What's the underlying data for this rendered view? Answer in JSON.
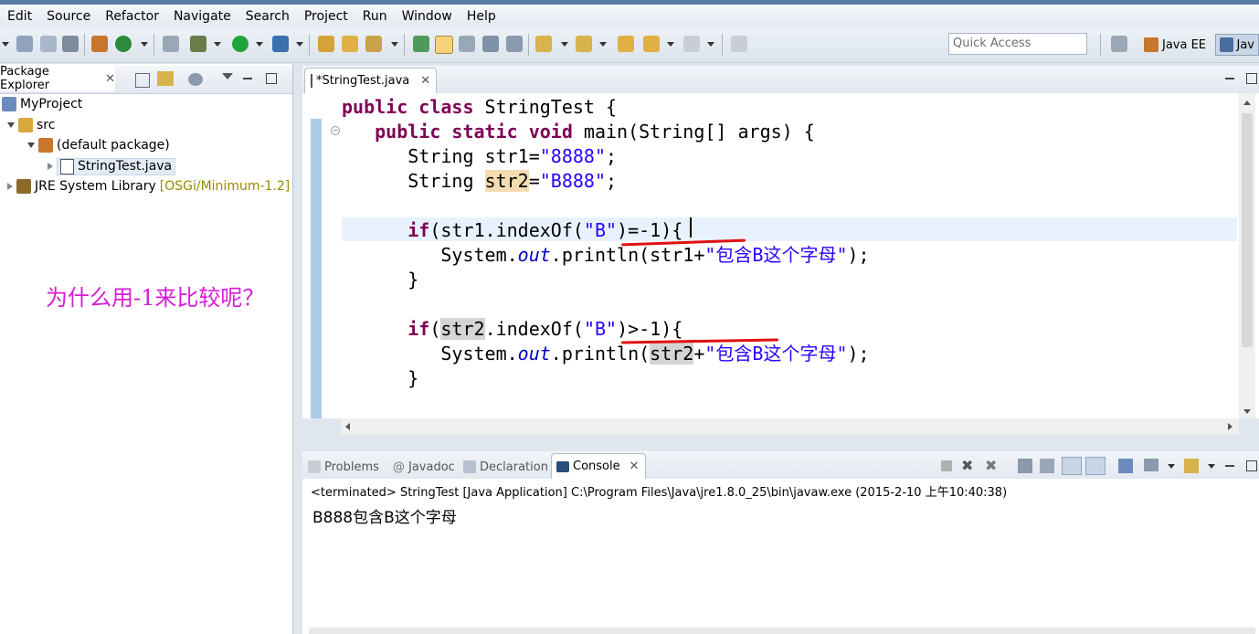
{
  "menu": [
    "Edit",
    "Source",
    "Refactor",
    "Navigate",
    "Search",
    "Project",
    "Run",
    "Window",
    "Help"
  ],
  "toolbar": {
    "quick_access_placeholder": "Quick Access",
    "perspective_java_ee": "Java EE",
    "perspective_java": "Jav"
  },
  "package_explorer": {
    "tab_label": "Package Explorer",
    "project": "MyProject",
    "src": "src",
    "package": "(default package)",
    "file": "StringTest.java",
    "jre_label": "JRE System Library",
    "jre_version": "[OSGi/Minimum-1.2]"
  },
  "annotation": {
    "question": "为什么用-1来比较呢？"
  },
  "editor": {
    "tab_label": "*StringTest.java",
    "line1": {
      "kw1": "public",
      "kw2": "class",
      "rest": " StringTest {"
    },
    "line2": {
      "kw1": "public",
      "kw2": "static",
      "kw3": "void",
      "rest": " main(String[] args) {"
    },
    "line3": {
      "a": "String str1=",
      "s": "\"8888\"",
      "b": ";"
    },
    "line4": {
      "a": "String ",
      "var": "str2",
      "b": "=",
      "s": "\"B888\"",
      "c": ";"
    },
    "line5": {
      "kw": "if",
      "a": "(str1.indexOf(",
      "s": "\"B\"",
      "b": ")=-1){"
    },
    "line6": {
      "a": "System.",
      "f": "out",
      "b": ".println(str1+",
      "s": "\"包含B这个字母\"",
      "c": ");"
    },
    "line7": {
      "a": "}"
    },
    "line8": {
      "kw": "if",
      "a": "(",
      "var": "str2",
      "b": ".indexOf(",
      "s": "\"B\"",
      "c": ")>-1){"
    },
    "line9": {
      "a": "System.",
      "f": "out",
      "b": ".println(",
      "var": "str2",
      "c": "+",
      "s": "\"包含B这个字母\"",
      "d": ");"
    },
    "line10": {
      "a": "}"
    }
  },
  "console": {
    "tabs": {
      "problems": "Problems",
      "javadoc": "Javadoc",
      "declaration": "Declaration",
      "console": "Console"
    },
    "terminated": "<terminated> StringTest [Java Application] C:\\Program Files\\Java\\jre1.8.0_25\\bin\\javaw.exe (2015-2-10 上午10:40:38)",
    "output": "B888包含B这个字母"
  },
  "colors": {
    "keyword": "#7f0055",
    "string": "#2a00ff",
    "field": "#0000c0",
    "annotation": "#d81ad8",
    "underline": "#e01010"
  }
}
